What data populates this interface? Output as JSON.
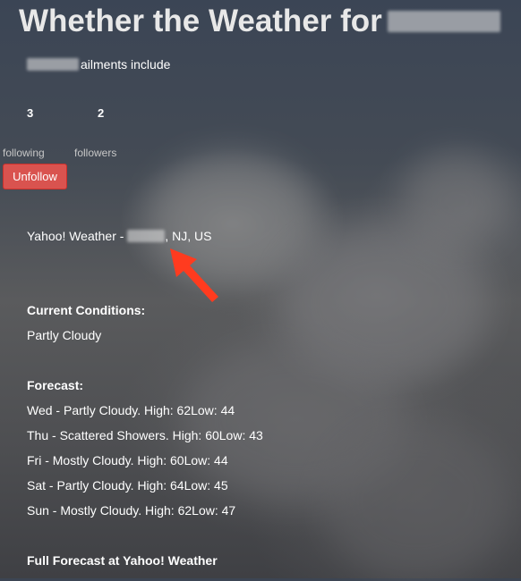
{
  "header": {
    "title_prefix": "Whether the Weather for"
  },
  "profile": {
    "ailments_text": "ailments include",
    "following_count": "3",
    "followers_count": "2",
    "following_label": "following",
    "followers_label": "followers",
    "unfollow_label": "Unfollow"
  },
  "weather": {
    "location_prefix": "Yahoo! Weather -",
    "location_suffix": ", NJ, US",
    "current_heading": "Current Conditions:",
    "current_conditions": "Partly Cloudy",
    "forecast_heading": "Forecast:",
    "forecast": [
      "Wed - Partly Cloudy. High: 62Low: 44",
      "Thu - Scattered Showers. High: 60Low: 43",
      "Fri - Mostly Cloudy. High: 60Low: 44",
      "Sat - Partly Cloudy. High: 64Low: 45",
      "Sun - Mostly Cloudy. High: 62Low: 47"
    ],
    "full_forecast_link": "Full Forecast at Yahoo! Weather"
  },
  "colors": {
    "unfollow_button": "#d9534f",
    "annotation_arrow": "#ff3b1f"
  },
  "icons": {
    "annotation": "red-arrow-icon"
  }
}
